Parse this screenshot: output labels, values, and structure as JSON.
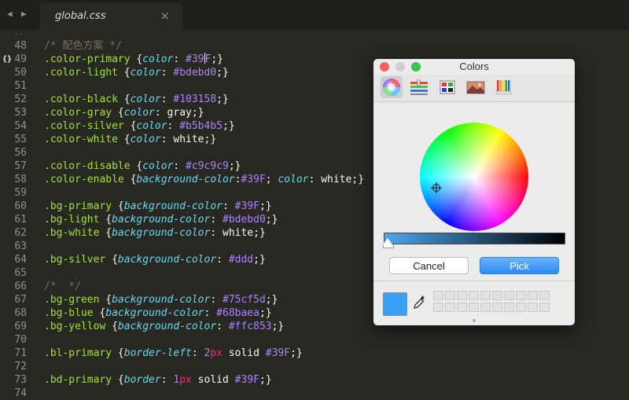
{
  "tabbar": {
    "back_icon": "triangle-left-icon",
    "forward_icon": "triangle-right-icon",
    "tab_title": "global.css",
    "close_glyph": "×"
  },
  "editor": {
    "lines": [
      {
        "n": "48",
        "t": [
          [
            "c-comment",
            "/* 配色方案 */"
          ]
        ]
      },
      {
        "n": "49",
        "marker": "{}",
        "t": [
          [
            "c-sel",
            ".color-primary "
          ],
          [
            "c-plain",
            "{"
          ],
          [
            "c-prop",
            "color"
          ],
          [
            "c-plain",
            ": "
          ],
          [
            "c-val",
            "#39"
          ],
          [
            "cursor",
            ""
          ],
          [
            "c-val",
            "F"
          ],
          [
            "c-plain",
            ";}"
          ]
        ]
      },
      {
        "n": "50",
        "t": [
          [
            "c-sel",
            ".color-light "
          ],
          [
            "c-plain",
            "{"
          ],
          [
            "c-prop",
            "color"
          ],
          [
            "c-plain",
            ": "
          ],
          [
            "c-val",
            "#bdebd0"
          ],
          [
            "c-plain",
            ";}"
          ]
        ]
      },
      {
        "n": "51",
        "t": []
      },
      {
        "n": "52",
        "t": [
          [
            "c-sel",
            ".color-black "
          ],
          [
            "c-plain",
            "{"
          ],
          [
            "c-prop",
            "color"
          ],
          [
            "c-plain",
            ": "
          ],
          [
            "c-val",
            "#103158"
          ],
          [
            "c-plain",
            ";}"
          ]
        ]
      },
      {
        "n": "53",
        "t": [
          [
            "c-sel",
            ".color-gray "
          ],
          [
            "c-plain",
            "{"
          ],
          [
            "c-prop",
            "color"
          ],
          [
            "c-plain",
            ": gray;}"
          ]
        ]
      },
      {
        "n": "54",
        "t": [
          [
            "c-sel",
            ".color-silver "
          ],
          [
            "c-plain",
            "{"
          ],
          [
            "c-prop",
            "color"
          ],
          [
            "c-plain",
            ": "
          ],
          [
            "c-val",
            "#b5b4b5"
          ],
          [
            "c-plain",
            ";}"
          ]
        ]
      },
      {
        "n": "55",
        "t": [
          [
            "c-sel",
            ".color-white "
          ],
          [
            "c-plain",
            "{"
          ],
          [
            "c-prop",
            "color"
          ],
          [
            "c-plain",
            ": white;}"
          ]
        ]
      },
      {
        "n": "56",
        "t": []
      },
      {
        "n": "57",
        "t": [
          [
            "c-sel",
            ".color-disable "
          ],
          [
            "c-plain",
            "{"
          ],
          [
            "c-prop",
            "color"
          ],
          [
            "c-plain",
            ": "
          ],
          [
            "c-val",
            "#c9c9c9"
          ],
          [
            "c-plain",
            ";}"
          ]
        ]
      },
      {
        "n": "58",
        "t": [
          [
            "c-sel",
            ".color-enable "
          ],
          [
            "c-plain",
            "{"
          ],
          [
            "c-prop",
            "background-color"
          ],
          [
            "c-plain",
            ":"
          ],
          [
            "c-val",
            "#39F"
          ],
          [
            "c-plain",
            "; "
          ],
          [
            "c-prop",
            "color"
          ],
          [
            "c-plain",
            ": white;}"
          ]
        ]
      },
      {
        "n": "59",
        "t": []
      },
      {
        "n": "60",
        "t": [
          [
            "c-sel",
            ".bg-primary "
          ],
          [
            "c-plain",
            "{"
          ],
          [
            "c-prop",
            "background-color"
          ],
          [
            "c-plain",
            ": "
          ],
          [
            "c-val",
            "#39F"
          ],
          [
            "c-plain",
            ";}"
          ]
        ]
      },
      {
        "n": "61",
        "t": [
          [
            "c-sel",
            ".bg-light "
          ],
          [
            "c-plain",
            "{"
          ],
          [
            "c-prop",
            "background-color"
          ],
          [
            "c-plain",
            ": "
          ],
          [
            "c-val",
            "#bdebd0"
          ],
          [
            "c-plain",
            ";}"
          ]
        ]
      },
      {
        "n": "62",
        "t": [
          [
            "c-sel",
            ".bg-white "
          ],
          [
            "c-plain",
            "{"
          ],
          [
            "c-prop",
            "background-color"
          ],
          [
            "c-plain",
            ": white;}"
          ]
        ]
      },
      {
        "n": "63",
        "t": []
      },
      {
        "n": "64",
        "t": [
          [
            "c-sel",
            ".bg-silver "
          ],
          [
            "c-plain",
            "{"
          ],
          [
            "c-prop",
            "background-color"
          ],
          [
            "c-plain",
            ": "
          ],
          [
            "c-val",
            "#ddd"
          ],
          [
            "c-plain",
            ";}"
          ]
        ]
      },
      {
        "n": "65",
        "t": []
      },
      {
        "n": "66",
        "t": [
          [
            "c-comment",
            "/*  */"
          ]
        ]
      },
      {
        "n": "67",
        "t": [
          [
            "c-sel",
            ".bg-green "
          ],
          [
            "c-plain",
            "{"
          ],
          [
            "c-prop",
            "background-color"
          ],
          [
            "c-plain",
            ": "
          ],
          [
            "c-val",
            "#75cf5d"
          ],
          [
            "c-plain",
            ";}"
          ]
        ]
      },
      {
        "n": "68",
        "t": [
          [
            "c-sel",
            ".bg-blue "
          ],
          [
            "c-plain",
            "{"
          ],
          [
            "c-prop",
            "background-color"
          ],
          [
            "c-plain",
            ": "
          ],
          [
            "c-val",
            "#68baea"
          ],
          [
            "c-plain",
            ";}"
          ]
        ]
      },
      {
        "n": "69",
        "t": [
          [
            "c-sel",
            ".bg-yellow "
          ],
          [
            "c-plain",
            "{"
          ],
          [
            "c-prop",
            "background-color"
          ],
          [
            "c-plain",
            ": "
          ],
          [
            "c-val",
            "#ffc853"
          ],
          [
            "c-plain",
            ";}"
          ]
        ]
      },
      {
        "n": "70",
        "t": []
      },
      {
        "n": "71",
        "t": [
          [
            "c-sel",
            ".bl-primary "
          ],
          [
            "c-plain",
            "{"
          ],
          [
            "c-prop",
            "border-left"
          ],
          [
            "c-plain",
            ": "
          ],
          [
            "c-val",
            "2"
          ],
          [
            "c-unit",
            "px"
          ],
          [
            "c-plain",
            " solid "
          ],
          [
            "c-val",
            "#39F"
          ],
          [
            "c-plain",
            ";}"
          ]
        ]
      },
      {
        "n": "72",
        "t": []
      },
      {
        "n": "73",
        "t": [
          [
            "c-sel",
            ".bd-primary "
          ],
          [
            "c-plain",
            "{"
          ],
          [
            "c-prop",
            "border"
          ],
          [
            "c-plain",
            ": "
          ],
          [
            "c-val",
            "1"
          ],
          [
            "c-unit",
            "px"
          ],
          [
            "c-plain",
            " solid "
          ],
          [
            "c-val",
            "#39F"
          ],
          [
            "c-plain",
            ";}"
          ]
        ]
      },
      {
        "n": "74",
        "t": []
      }
    ]
  },
  "picker": {
    "title": "Colors",
    "traffic_colors": [
      "#fc605c",
      "#fdbc40",
      "#34c84a"
    ],
    "tabs": [
      "color-wheel-icon",
      "color-sliders-icon",
      "color-palettes-icon",
      "image-palettes-icon",
      "crayons-icon"
    ],
    "selected_tab": "color-wheel-icon",
    "brightness_fraction": 0.0,
    "cancel_label": "Cancel",
    "pick_label": "Pick",
    "current_color": "#39a0f5",
    "eyedropper_icon": "eyedropper-icon",
    "swatch_cells": 20
  }
}
